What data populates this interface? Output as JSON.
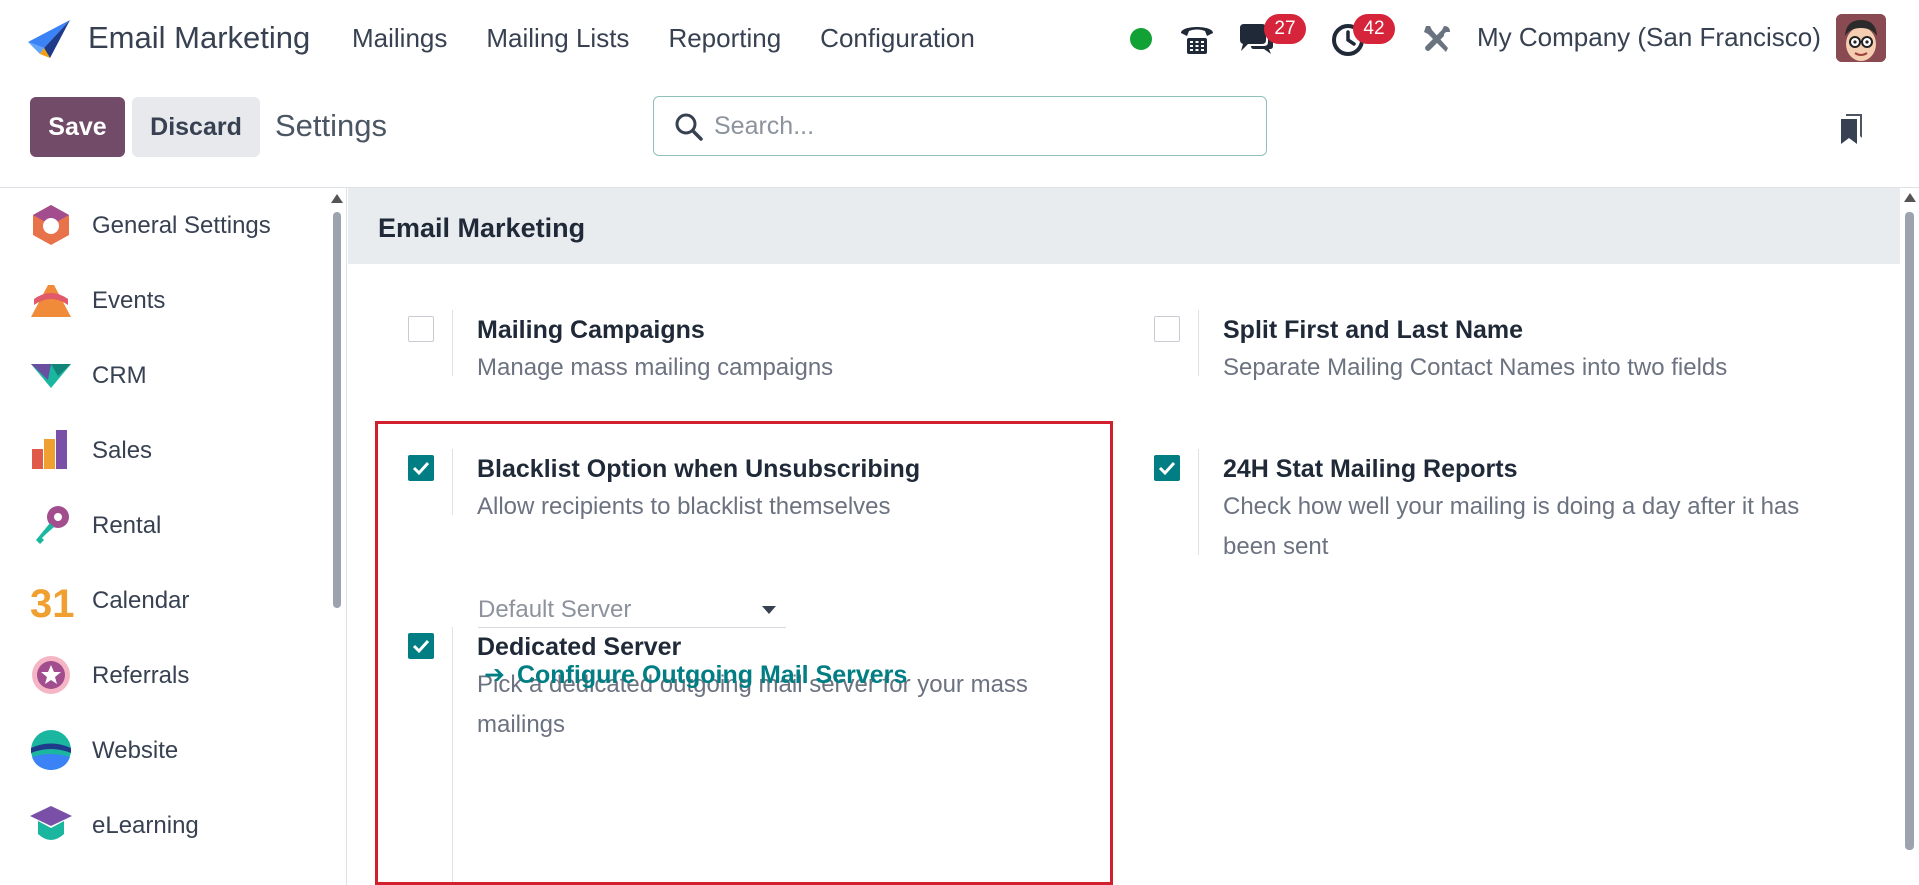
{
  "navbar": {
    "app_name": "Email Marketing",
    "menu": [
      "Mailings",
      "Mailing Lists",
      "Reporting",
      "Configuration"
    ],
    "messages_count": "27",
    "activities_count": "42",
    "company": "My Company (San Francisco)"
  },
  "control": {
    "save_label": "Save",
    "discard_label": "Discard",
    "title": "Settings",
    "search_placeholder": "Search..."
  },
  "sidebar": {
    "items": [
      {
        "label": "General Settings",
        "icon": "general-settings-icon"
      },
      {
        "label": "Events",
        "icon": "events-icon"
      },
      {
        "label": "CRM",
        "icon": "crm-icon"
      },
      {
        "label": "Sales",
        "icon": "sales-icon"
      },
      {
        "label": "Rental",
        "icon": "rental-icon"
      },
      {
        "label": "Calendar",
        "icon": "calendar-icon"
      },
      {
        "label": "Referrals",
        "icon": "referrals-icon"
      },
      {
        "label": "Website",
        "icon": "website-icon"
      },
      {
        "label": "eLearning",
        "icon": "elearning-icon"
      }
    ],
    "calendar_day": "31"
  },
  "main": {
    "section_title": "Email Marketing",
    "settings": [
      {
        "title": "Mailing Campaigns",
        "desc": "Manage mass mailing campaigns",
        "checked": false
      },
      {
        "title": "Split First and Last Name",
        "desc": "Separate Mailing Contact Names into two fields",
        "checked": false
      },
      {
        "title": "Blacklist Option when Unsubscribing",
        "desc": "Allow recipients to blacklist themselves",
        "checked": true
      },
      {
        "title": "24H Stat Mailing Reports",
        "desc": "Check how well your mailing is doing a day after it has been sent",
        "checked": true
      },
      {
        "title": "Dedicated Server",
        "desc": "Pick a dedicated outgoing mail server for your mass mailings",
        "checked": true
      }
    ],
    "server_value": "Default Server",
    "config_link": "Configure Outgoing Mail Servers"
  },
  "colors": {
    "primary": "#714b67",
    "accent": "#017e84",
    "badge": "#d6253a",
    "highlight": "#d3202f"
  }
}
